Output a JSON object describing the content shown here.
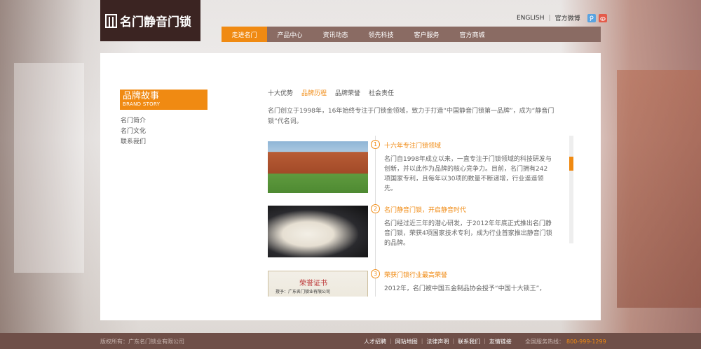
{
  "logo": {
    "text": "名门静音门锁"
  },
  "top_links": {
    "english": "ENGLISH",
    "weibo": "官方微博"
  },
  "nav": [
    {
      "label": "走进名门",
      "active": true
    },
    {
      "label": "产品中心"
    },
    {
      "label": "资讯动态"
    },
    {
      "label": "领先科技"
    },
    {
      "label": "客户服务"
    },
    {
      "label": "官方商城"
    }
  ],
  "sidebar": {
    "title_cn": "品牌故事",
    "title_en": "BRAND STORY",
    "items": [
      "名门简介",
      "名门文化",
      "联系我们"
    ]
  },
  "tabs": [
    {
      "label": "十大优势"
    },
    {
      "label": "品牌历程",
      "active": true
    },
    {
      "label": "品牌荣誉"
    },
    {
      "label": "社会责任"
    }
  ],
  "intro": "名门创立于1998年，16年始终专注于门锁金领域，致力于打造“中国静音门锁第一品牌”，成为“静音门锁”代名词。",
  "timeline": [
    {
      "num": "1",
      "title": "十六年专注门锁领域",
      "text": "名门自1998年成立以来，一直专注于门锁领域的科技研发与创新，并以此作为品牌的核心竞争力。目前，名门拥有242项国家专利，且每年以30项的数量不断递增，行业遥遥领先。"
    },
    {
      "num": "2",
      "title": "名门静音门锁，开启静音时代",
      "text": "名门经过近三年的潜心研发，于2012年年底正式推出名门静音门锁，荣获4项国家技术专利，成为行业首家推出静音门锁的品牌。"
    },
    {
      "num": "3",
      "title": "荣获门锁行业最高荣誉",
      "text": "2012年，名门被中国五金制品协会授予“中国十大锁王”，",
      "cert_title": "荣誉证书",
      "cert_line": "授予：广东名门锁业有限公司"
    }
  ],
  "footer": {
    "copyright": "版权所有：广东名门锁业有限公司",
    "links": [
      "人才招聘",
      "网站地图",
      "法律声明",
      "联系我们",
      "友情链接"
    ],
    "hotline_label": "全国服务热线：",
    "hotline_number": "800-999-1299"
  }
}
